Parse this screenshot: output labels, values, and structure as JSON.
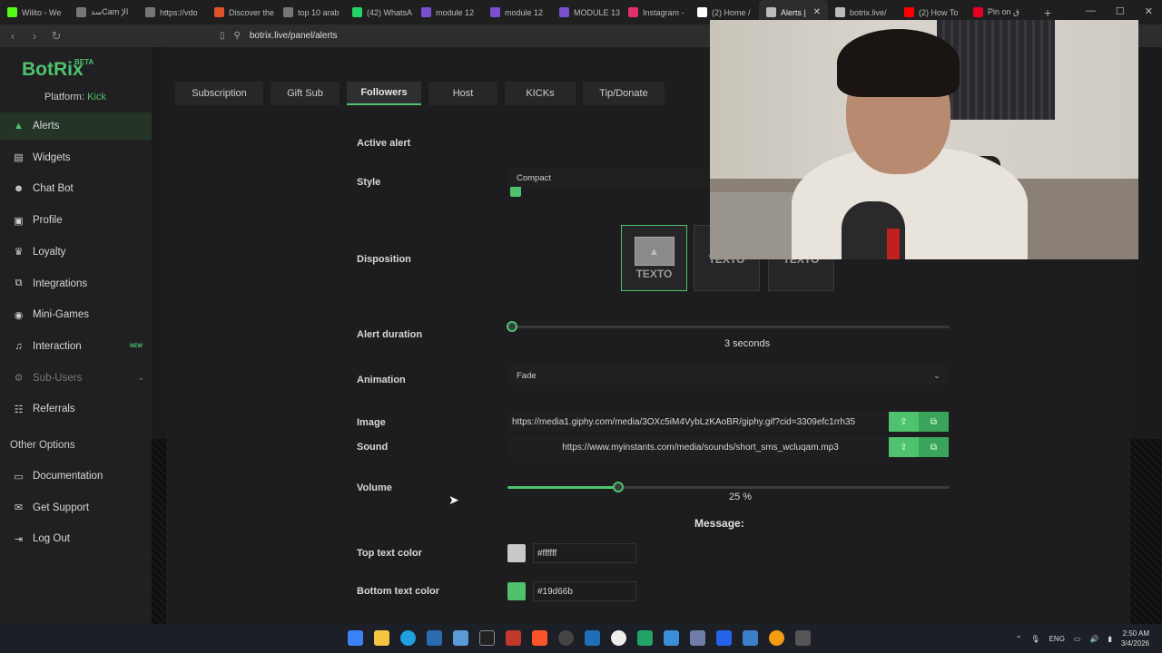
{
  "browser": {
    "tabs": [
      {
        "label": "Wilito - We",
        "color": "#53fc18"
      },
      {
        "label": "سدCam الإ",
        "color": "#777777"
      },
      {
        "label": "https://vdo",
        "color": "#777777"
      },
      {
        "label": "Discover the",
        "color": "#e0502a"
      },
      {
        "label": "top 10 arab",
        "color": "#777777"
      },
      {
        "label": "(42) WhatsA",
        "color": "#25d366"
      },
      {
        "label": "module 12",
        "color": "#7a4fd0"
      },
      {
        "label": "module 12",
        "color": "#7a4fd0"
      },
      {
        "label": "MODULE 13",
        "color": "#7a4fd0"
      },
      {
        "label": "Instagram -",
        "color": "#e1306c"
      },
      {
        "label": "(2) Home /",
        "color": "#ffffff"
      },
      {
        "label": "Alerts |",
        "color": "#bbbbbb",
        "active": true
      },
      {
        "label": "botrix.live/",
        "color": "#bbbbbb"
      },
      {
        "label": "(2) How To",
        "color": "#ff0000"
      },
      {
        "label": "Pin on ق",
        "color": "#e60023"
      }
    ],
    "new_tab": "+",
    "close_tab": "✕",
    "url": "botrix.live/panel/alerts"
  },
  "sidebar": {
    "logo": "BotRix",
    "logo_badge": "BETA",
    "platform_label": "Platform:",
    "platform_value": "Kick",
    "items": [
      {
        "label": "Alerts",
        "icon": "▲"
      },
      {
        "label": "Widgets",
        "icon": "▤"
      },
      {
        "label": "Chat Bot",
        "icon": "☻"
      },
      {
        "label": "Profile",
        "icon": "▣"
      },
      {
        "label": "Loyalty",
        "icon": "♛"
      },
      {
        "label": "Integrations",
        "icon": "⧉"
      },
      {
        "label": "Mini-Games",
        "icon": "◉"
      },
      {
        "label": "Interaction",
        "icon": "♫",
        "badge": "NEW"
      },
      {
        "label": "Sub-Users",
        "icon": "⚙"
      },
      {
        "label": "Referrals",
        "icon": "☷"
      }
    ],
    "other_title": "Other Options",
    "other_items": [
      {
        "label": "Documentation",
        "icon": "▭"
      },
      {
        "label": "Get Support",
        "icon": "✉"
      },
      {
        "label": "Log Out",
        "icon": "⇥"
      }
    ]
  },
  "alert_tabs": [
    "Subscription",
    "Gift Sub",
    "Followers",
    "Host",
    "KICKs",
    "Tip/Donate"
  ],
  "form": {
    "active_alert_label": "Active alert",
    "style_label": "Style",
    "style_value": "Compact",
    "disposition_label": "Disposition",
    "disposition_text": "TEXTO",
    "duration_label": "Alert duration",
    "duration_value": "3 seconds",
    "duration_fraction": 0.01,
    "animation_label": "Animation",
    "animation_value": "Fade",
    "image_label": "Image",
    "image_url": "https://media1.giphy.com/media/3OXc5iM4VybLzKAoBR/giphy.gif?cid=3309efc1rrh35",
    "sound_label": "Sound",
    "sound_url": "https://www.myinstants.com/media/sounds/short_sms_wcluqam.mp3",
    "volume_label": "Volume",
    "volume_value": "25 %",
    "volume_fraction": 0.25,
    "message_title": "Message:",
    "top_color_label": "Top text color",
    "top_color_value": "#ffffff",
    "top_swatch": "#c8c8c8",
    "bottom_color_label": "Bottom text color",
    "bottom_color_value": "#19d66b",
    "bottom_swatch": "#4ec26d"
  },
  "tray": {
    "lang": "ENG",
    "time": "2:50 AM",
    "date": "3/4/2026"
  }
}
